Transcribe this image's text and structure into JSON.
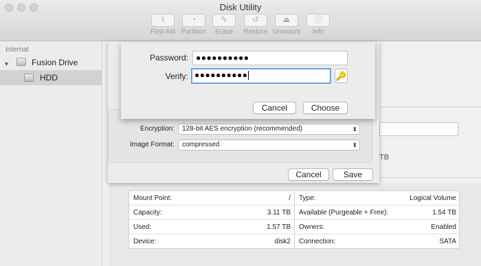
{
  "window": {
    "title": "Disk Utility"
  },
  "toolbar": {
    "items": [
      {
        "label": "First Aid",
        "icon": "first-aid-icon",
        "glyph": "⚕"
      },
      {
        "label": "Partition",
        "icon": "partition-icon",
        "glyph": "◔"
      },
      {
        "label": "Erase",
        "icon": "erase-icon",
        "glyph": "✎"
      },
      {
        "label": "Restore",
        "icon": "restore-icon",
        "glyph": "↺"
      },
      {
        "label": "Unmount",
        "icon": "unmount-icon",
        "glyph": "⏏"
      },
      {
        "label": "Info",
        "icon": "info-icon",
        "glyph": "ⓘ"
      }
    ]
  },
  "sidebar": {
    "heading": "Internal",
    "items": [
      {
        "label": "Fusion Drive",
        "icon": "hard-drive-icon"
      },
      {
        "label": "HDD",
        "icon": "hard-drive-icon"
      }
    ]
  },
  "password_dialog": {
    "password_label": "Password:",
    "password_value": "●●●●●●●●●●",
    "verify_label": "Verify:",
    "verify_value": "●●●●●●●●●●",
    "key_icon": "key-icon",
    "cancel_label": "Cancel",
    "choose_label": "Choose"
  },
  "image_sheet": {
    "encryption_label": "Encryption:",
    "encryption_value": "128-bit AES encryption (recommended)",
    "format_label": "Image Format:",
    "format_value": "compressed",
    "cancel_label": "Cancel",
    "save_label": "Save"
  },
  "background": {
    "partial_text": "TB"
  },
  "info": {
    "left": [
      {
        "key": "Mount Point:",
        "value": "/"
      },
      {
        "key": "Capacity:",
        "value": "3.11 TB"
      },
      {
        "key": "Used:",
        "value": "1.57 TB"
      },
      {
        "key": "Device:",
        "value": "disk2"
      }
    ],
    "right": [
      {
        "key": "Type:",
        "value": "Logical Volume"
      },
      {
        "key": "Available (Purgeable + Free):",
        "value": "1.54 TB"
      },
      {
        "key": "Owners:",
        "value": "Enabled"
      },
      {
        "key": "Connection:",
        "value": "SATA"
      }
    ]
  },
  "colors": {
    "focus_ring": "#6aa4e8",
    "sidebar_selected": "#d2d2d2"
  }
}
